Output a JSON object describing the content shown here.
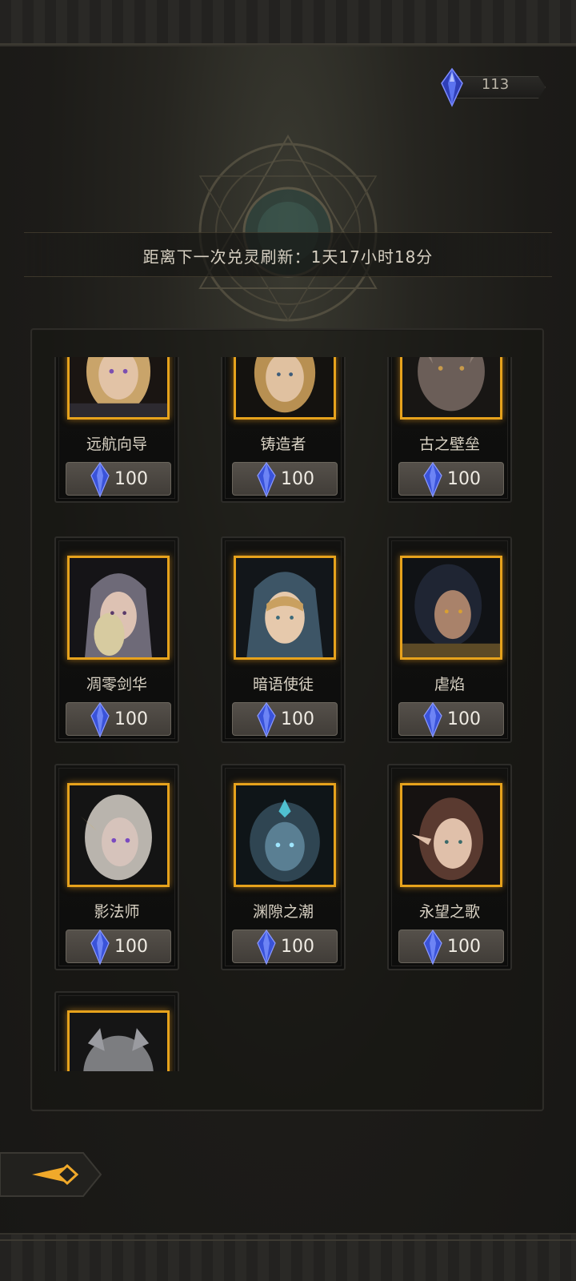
{
  "header": {
    "currency_icon": "crystal-gem-icon",
    "currency_value": "113"
  },
  "refresh": {
    "text": "距离下一次兑灵刷新：1天17小时18分"
  },
  "colors": {
    "portrait_frame": "#e6a21c",
    "gem_blue": "#3a53d9",
    "price_button": "#4a4640"
  },
  "cards": [
    {
      "name": "远航向导",
      "price": "100",
      "portrait": "blonde-woman-portrait-icon"
    },
    {
      "name": "铸造者",
      "price": "100",
      "portrait": "braided-blonde-portrait-icon"
    },
    {
      "name": "古之壁垒",
      "price": "100",
      "portrait": "dragon-portrait-icon"
    },
    {
      "name": "凋零剑华",
      "price": "100",
      "portrait": "hooded-elf-portrait-icon"
    },
    {
      "name": "暗语使徒",
      "price": "100",
      "portrait": "hooded-girl-portrait-icon"
    },
    {
      "name": "虐焰",
      "price": "100",
      "portrait": "dark-haired-man-portrait-icon"
    },
    {
      "name": "影法师",
      "price": "100",
      "portrait": "silver-elf-portrait-icon"
    },
    {
      "name": "渊隙之潮",
      "price": "100",
      "portrait": "sea-creature-portrait-icon"
    },
    {
      "name": "永望之歌",
      "price": "100",
      "portrait": "elf-woman-portrait-icon"
    },
    {
      "name": "",
      "price": "",
      "portrait": "werewolf-portrait-icon"
    }
  ],
  "navigation": {
    "back_icon": "back-arrow-icon"
  }
}
